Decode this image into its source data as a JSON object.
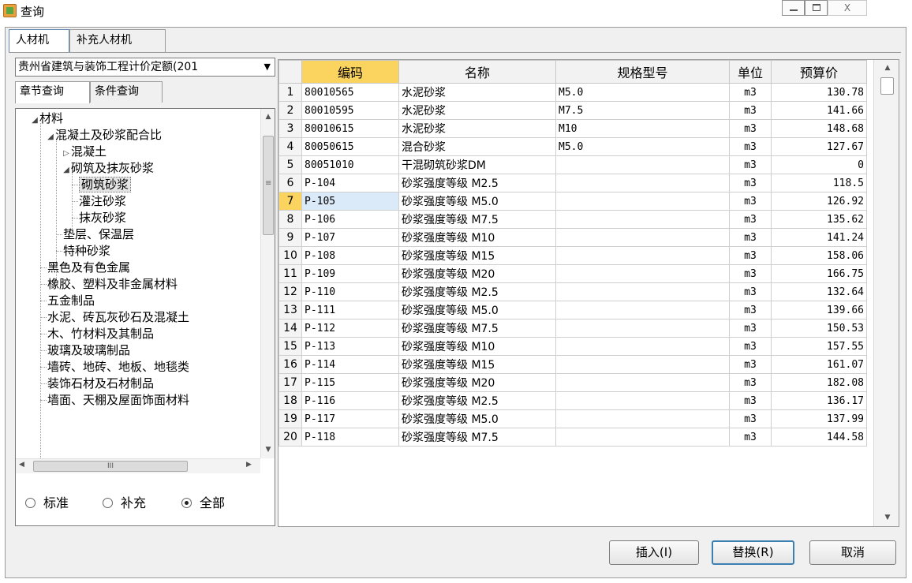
{
  "window": {
    "title": "查询",
    "min_glyph": "",
    "max_glyph": "",
    "close_glyph": "X"
  },
  "tabs": [
    {
      "label": "人材机",
      "active": true
    },
    {
      "label": "补充人材机",
      "active": false
    }
  ],
  "quota_select": {
    "value": "贵州省建筑与装饰工程计价定额(201",
    "arrow": "▼"
  },
  "subtabs": [
    {
      "label": "章节查询",
      "active": true
    },
    {
      "label": "条件查询",
      "active": false
    }
  ],
  "tree": {
    "nodes": [
      {
        "label": "材料",
        "expander": "◢"
      },
      {
        "label": "混凝土及砂浆配合比",
        "expander": "◢"
      },
      {
        "label": "混凝土",
        "expander": "▷"
      },
      {
        "label": "砌筑及抹灰砂浆",
        "expander": "◢"
      },
      {
        "label": "砌筑砂浆",
        "selected": true
      },
      {
        "label": "灌注砂浆"
      },
      {
        "label": "抹灰砂浆"
      },
      {
        "label": "垫层、保温层"
      },
      {
        "label": "特种砂浆"
      },
      {
        "label": "黑色及有色金属"
      },
      {
        "label": "橡胶、塑料及非金属材料"
      },
      {
        "label": "五金制品"
      },
      {
        "label": "水泥、砖瓦灰砂石及混凝土"
      },
      {
        "label": "木、竹材料及其制品"
      },
      {
        "label": "玻璃及玻璃制品"
      },
      {
        "label": "墙砖、地砖、地板、地毯类"
      },
      {
        "label": "装饰石材及石材制品"
      },
      {
        "label": "墙面、天棚及屋面饰面材料"
      }
    ],
    "scroll_up": "▲",
    "scroll_down": "▼",
    "hscroll_left": "◀",
    "hscroll_right": "▶",
    "hthumb_grip": "III",
    "vthumb_grip": "≡"
  },
  "radio_options": [
    {
      "label": "标准",
      "checked": false
    },
    {
      "label": "补充",
      "checked": false
    },
    {
      "label": "全部",
      "checked": true
    }
  ],
  "table": {
    "columns": [
      "",
      "编码",
      "名称",
      "规格型号",
      "单位",
      "预算价"
    ],
    "selected_row": 7,
    "rows": [
      {
        "no": "1",
        "code": "80010565",
        "name": "水泥砂浆",
        "spec": "M5.0",
        "unit": "m3",
        "price": "130.78"
      },
      {
        "no": "2",
        "code": "80010595",
        "name": "水泥砂浆",
        "spec": "M7.5",
        "unit": "m3",
        "price": "141.66"
      },
      {
        "no": "3",
        "code": "80010615",
        "name": "水泥砂浆",
        "spec": "M10",
        "unit": "m3",
        "price": "148.68"
      },
      {
        "no": "4",
        "code": "80050615",
        "name": "混合砂浆",
        "spec": "M5.0",
        "unit": "m3",
        "price": "127.67"
      },
      {
        "no": "5",
        "code": "80051010",
        "name": "干混砌筑砂浆DM",
        "spec": "",
        "unit": "m3",
        "price": "0"
      },
      {
        "no": "6",
        "code": "P-104",
        "name": "砂浆强度等级 M2.5",
        "spec": "",
        "unit": "m3",
        "price": "118.5"
      },
      {
        "no": "7",
        "code": "P-105",
        "name": "砂浆强度等级 M5.0",
        "spec": "",
        "unit": "m3",
        "price": "126.92"
      },
      {
        "no": "8",
        "code": "P-106",
        "name": "砂浆强度等级 M7.5",
        "spec": "",
        "unit": "m3",
        "price": "135.62"
      },
      {
        "no": "9",
        "code": "P-107",
        "name": "砂浆强度等级 M10",
        "spec": "",
        "unit": "m3",
        "price": "141.24"
      },
      {
        "no": "10",
        "code": "P-108",
        "name": "砂浆强度等级 M15",
        "spec": "",
        "unit": "m3",
        "price": "158.06"
      },
      {
        "no": "11",
        "code": "P-109",
        "name": "砂浆强度等级 M20",
        "spec": "",
        "unit": "m3",
        "price": "166.75"
      },
      {
        "no": "12",
        "code": "P-110",
        "name": "砂浆强度等级 M2.5",
        "spec": "",
        "unit": "m3",
        "price": "132.64"
      },
      {
        "no": "13",
        "code": "P-111",
        "name": "砂浆强度等级 M5.0",
        "spec": "",
        "unit": "m3",
        "price": "139.66"
      },
      {
        "no": "14",
        "code": "P-112",
        "name": "砂浆强度等级 M7.5",
        "spec": "",
        "unit": "m3",
        "price": "150.53"
      },
      {
        "no": "15",
        "code": "P-113",
        "name": "砂浆强度等级 M10",
        "spec": "",
        "unit": "m3",
        "price": "157.55"
      },
      {
        "no": "16",
        "code": "P-114",
        "name": "砂浆强度等级 M15",
        "spec": "",
        "unit": "m3",
        "price": "161.07"
      },
      {
        "no": "17",
        "code": "P-115",
        "name": "砂浆强度等级 M20",
        "spec": "",
        "unit": "m3",
        "price": "182.08"
      },
      {
        "no": "18",
        "code": "P-116",
        "name": "砂浆强度等级 M2.5",
        "spec": "",
        "unit": "m3",
        "price": "136.17"
      },
      {
        "no": "19",
        "code": "P-117",
        "name": "砂浆强度等级 M5.0",
        "spec": "",
        "unit": "m3",
        "price": "137.99"
      },
      {
        "no": "20",
        "code": "P-118",
        "name": "砂浆强度等级 M7.5",
        "spec": "",
        "unit": "m3",
        "price": "144.58"
      }
    ],
    "scroll_up": "▲",
    "scroll_down": "▼"
  },
  "buttons": {
    "insert": "插入(I)",
    "replace": "替换(R)",
    "cancel": "取消"
  },
  "colors": {
    "header_highlight": "#fbd35f",
    "selected_cell": "#dbeaf8",
    "dialog_bg": "#f0f0f0",
    "default_button_border": "#3c7fb1"
  }
}
